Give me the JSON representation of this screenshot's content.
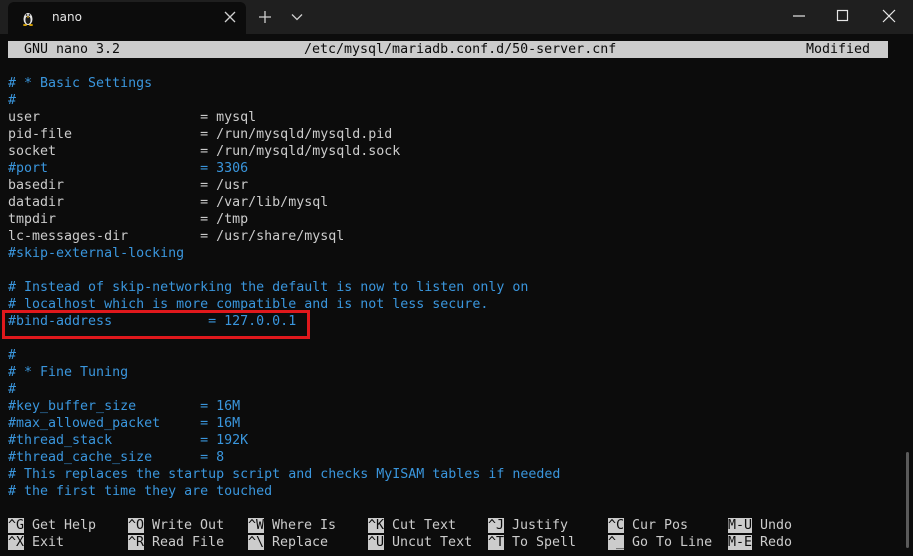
{
  "window": {
    "tab_title": "nano",
    "icons": {
      "tab": "linux-penguin-icon",
      "close_tab": "close-icon",
      "new_tab": "plus-icon",
      "dropdown": "chevron-down-icon",
      "minimize": "minimize-icon",
      "maximize": "maximize-icon",
      "close_window": "close-icon"
    }
  },
  "nano": {
    "version": "GNU nano 3.2",
    "file_path": "/etc/mysql/mariadb.conf.d/50-server.cnf",
    "status": "Modified"
  },
  "lines": [
    {
      "text": "# * Basic Settings",
      "style": "comment"
    },
    {
      "text": "#",
      "style": "comment"
    },
    {
      "text": "user                    = mysql",
      "style": "text"
    },
    {
      "text": "pid-file                = /run/mysqld/mysqld.pid",
      "style": "text"
    },
    {
      "text": "socket                  = /run/mysqld/mysqld.sock",
      "style": "text"
    },
    {
      "text": "#port                   = 3306",
      "style": "comment"
    },
    {
      "text": "basedir                 = /usr",
      "style": "text"
    },
    {
      "text": "datadir                 = /var/lib/mysql",
      "style": "text"
    },
    {
      "text": "tmpdir                  = /tmp",
      "style": "text"
    },
    {
      "text": "lc-messages-dir         = /usr/share/mysql",
      "style": "text"
    },
    {
      "text": "#skip-external-locking",
      "style": "comment"
    },
    {
      "text": "",
      "style": "text"
    },
    {
      "text": "# Instead of skip-networking the default is now to listen only on",
      "style": "comment"
    },
    {
      "text": "# localhost which is more compatible and is not less secure.",
      "style": "comment"
    },
    {
      "text": "#bind-address            = 127.0.0.1",
      "style": "comment"
    },
    {
      "text": "",
      "style": "text"
    },
    {
      "text": "#",
      "style": "comment"
    },
    {
      "text": "# * Fine Tuning",
      "style": "comment"
    },
    {
      "text": "#",
      "style": "comment"
    },
    {
      "text": "#key_buffer_size        = 16M",
      "style": "comment"
    },
    {
      "text": "#max_allowed_packet     = 16M",
      "style": "comment"
    },
    {
      "text": "#thread_stack           = 192K",
      "style": "comment"
    },
    {
      "text": "#thread_cache_size      = 8",
      "style": "comment"
    },
    {
      "text": "# This replaces the startup script and checks MyISAM tables if needed",
      "style": "comment"
    },
    {
      "text": "# the first time they are touched",
      "style": "comment"
    }
  ],
  "shortcuts": [
    {
      "key": "^G",
      "label": "Get Help"
    },
    {
      "key": "^O",
      "label": "Write Out"
    },
    {
      "key": "^W",
      "label": "Where Is"
    },
    {
      "key": "^K",
      "label": "Cut Text"
    },
    {
      "key": "^J",
      "label": "Justify"
    },
    {
      "key": "^C",
      "label": "Cur Pos"
    },
    {
      "key": "M-U",
      "label": "Undo"
    },
    {
      "key": "^X",
      "label": "Exit"
    },
    {
      "key": "^R",
      "label": "Read File"
    },
    {
      "key": "^\\",
      "label": "Replace"
    },
    {
      "key": "^U",
      "label": "Uncut Text"
    },
    {
      "key": "^T",
      "label": "To Spell"
    },
    {
      "key": "^_",
      "label": "Go To Line"
    },
    {
      "key": "M-E",
      "label": "Redo"
    }
  ],
  "colors": {
    "comment": "#3a96dd",
    "text": "#cccccc",
    "highlight_border": "#e0181c"
  }
}
